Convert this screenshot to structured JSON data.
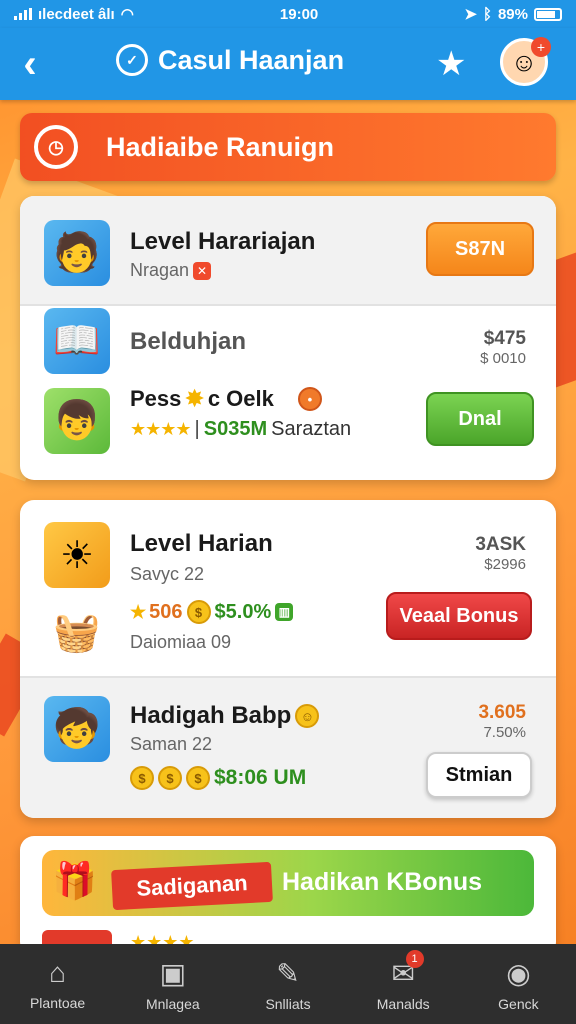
{
  "status_bar": {
    "carrier": "ılecdeet âlı",
    "time": "19:00",
    "battery": "89%"
  },
  "header": {
    "title": "Casul Haanjan"
  },
  "banner": {
    "title": "Hadiaibe Ranuign"
  },
  "card1": {
    "row1": {
      "title": "Level Harariajan",
      "subtitle": "Nragan",
      "button": "S87N"
    },
    "row2": {
      "title": "Belduhjan",
      "price": "$475",
      "price_sub": "$ 0010"
    },
    "row3": {
      "title": "Pess",
      "title_suffix": "c Oelk",
      "separator": "|",
      "green_value": "S035M",
      "tail": "Saraztan",
      "button": "Dnal"
    }
  },
  "card2": {
    "row1": {
      "title": "Level Harian",
      "subtitle": "Savyc 22",
      "price": "3ASK",
      "price_sub": "$2996"
    },
    "row2": {
      "value1": "506",
      "value2": "$5.0%",
      "sub": "Daiomiaa 09",
      "button": "Veaal Bonus"
    },
    "row3": {
      "title": "Hadigah Babp",
      "subtitle": "Saman 22",
      "green_value": "$8:06 UM",
      "price": "3.605",
      "price_sub": "7.50%",
      "button": "Stmian"
    }
  },
  "card3": {
    "ribbon": "Sadiganan",
    "title": "Hadikan KBonus"
  },
  "bottom_nav": [
    {
      "label": "Plantoae"
    },
    {
      "label": "Mnlagea"
    },
    {
      "label": "Snlliats"
    },
    {
      "label": "Manalds",
      "badge": "1"
    },
    {
      "label": "Genck"
    }
  ],
  "icons": {
    "back": "chevron-left-icon",
    "logo": "clock-icon",
    "star": "star-icon",
    "avatar": "avatar-icon"
  },
  "colors": {
    "header": "#2196e6",
    "banner": "#f24f22",
    "button_orange": "#f5861a",
    "button_green": "#4ba52a",
    "button_red": "#c92424",
    "nav_bg": "#2e2e2e"
  }
}
